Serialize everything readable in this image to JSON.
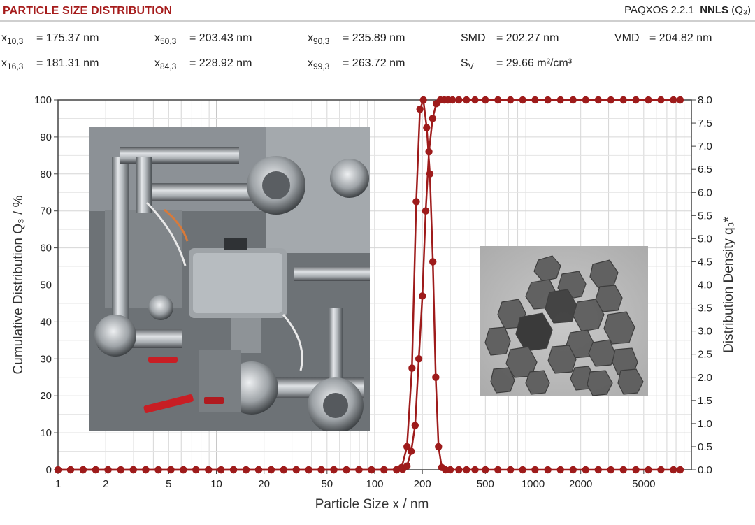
{
  "header": {
    "title": "PARTICLE SIZE DISTRIBUTION",
    "software": "PAQXOS 2.2.1",
    "method": "NNLS",
    "qtype": "(Q₃)"
  },
  "stats": [
    {
      "sym": "x",
      "sub": "10,3",
      "value": "= 175.37 nm"
    },
    {
      "sym": "x",
      "sub": "50,3",
      "value": "= 203.43 nm"
    },
    {
      "sym": "x",
      "sub": "90,3",
      "value": "= 235.89 nm"
    },
    {
      "sym": "SMD",
      "sub": "",
      "value": "= 202.27 nm"
    },
    {
      "sym": "VMD",
      "sub": "",
      "value": "= 204.82 nm"
    },
    {
      "sym": "x",
      "sub": "16,3",
      "value": "= 181.31 nm"
    },
    {
      "sym": "x",
      "sub": "84,3",
      "value": "= 228.92 nm"
    },
    {
      "sym": "x",
      "sub": "99,3",
      "value": "= 263.72 nm"
    },
    {
      "sym": "S",
      "sub": "V",
      "value": "= 29.66 m²/cm³"
    }
  ],
  "images": {
    "left_photo": "industrial-piping-apparatus-photo",
    "right_photo": "tem-nanoparticle-micrograph"
  },
  "chart_data": {
    "type": "line",
    "x_scale": "log",
    "xlabel": "Particle Size x / nm",
    "ylabel": "Cumulative Distribution Q₃ / %",
    "y2label": "Distribution Density q₃*",
    "xlim": [
      1,
      10000
    ],
    "ylim": [
      0,
      100
    ],
    "y2lim": [
      0,
      8.0
    ],
    "grid": true,
    "xticks": [
      {
        "v": 1,
        "label": "1"
      },
      {
        "v": 2,
        "label": "2"
      },
      {
        "v": 5,
        "label": "5"
      },
      {
        "v": 10,
        "label": "10"
      },
      {
        "v": 20,
        "label": "20"
      },
      {
        "v": 50,
        "label": "50"
      },
      {
        "v": 100,
        "label": "100"
      },
      {
        "v": 200,
        "label": "200"
      },
      {
        "v": 500,
        "label": "500"
      },
      {
        "v": 1000,
        "label": "1000"
      },
      {
        "v": 2000,
        "label": "2000"
      },
      {
        "v": 5000,
        "label": "5000"
      }
    ],
    "yticks": [
      "0",
      "10",
      "20",
      "30",
      "40",
      "50",
      "60",
      "70",
      "80",
      "90",
      "100"
    ],
    "y2ticks": [
      "0.0",
      "0.5",
      "1.0",
      "1.5",
      "2.0",
      "2.5",
      "3.0",
      "3.5",
      "4.0",
      "4.5",
      "5.0",
      "5.5",
      "6.0",
      "6.5",
      "7.0",
      "7.5",
      "8.0"
    ],
    "color": "#9e1b1b",
    "series": [
      {
        "role": "cumulative",
        "axis": "left",
        "x": [
          1,
          1.2,
          1.44,
          1.73,
          2.07,
          2.49,
          2.99,
          3.58,
          4.3,
          5.16,
          6.19,
          7.43,
          8.92,
          10.7,
          12.84,
          15.4,
          18.49,
          22.19,
          26.62,
          31.95,
          38.34,
          46.0,
          55.2,
          66.25,
          79.5,
          95.4,
          114.5,
          137.4,
          150,
          158,
          166,
          175,
          185,
          194,
          203,
          213,
          222,
          232,
          242,
          252,
          262,
          275,
          290,
          310,
          340,
          380,
          430,
          500,
          600,
          720,
          860,
          1030,
          1240,
          1490,
          1790,
          2150,
          2580,
          3100,
          3720,
          4460,
          5350,
          6420,
          7700,
          8500
        ],
        "values": [
          0,
          0,
          0,
          0,
          0,
          0,
          0,
          0,
          0,
          0,
          0,
          0,
          0,
          0,
          0,
          0,
          0,
          0,
          0,
          0,
          0,
          0,
          0,
          0,
          0,
          0,
          0,
          0,
          0.6,
          3,
          12,
          29,
          57,
          81,
          95,
          92,
          80,
          64,
          50,
          36,
          23,
          10,
          100,
          100,
          100,
          100,
          100,
          100,
          100,
          100,
          100,
          100,
          100,
          100,
          100,
          100,
          100,
          100,
          100,
          100,
          100,
          100,
          100,
          100
        ]
      }
    ],
    "cumulative_points": {
      "x": [
        1,
        1.2,
        1.44,
        1.73,
        2.07,
        2.49,
        2.99,
        3.58,
        4.3,
        5.16,
        6.19,
        7.43,
        8.92,
        10.7,
        12.84,
        15.4,
        18.49,
        22.19,
        26.62,
        31.95,
        38.34,
        46.0,
        55.2,
        66.25,
        79.5,
        95.4,
        114.5,
        137.4,
        150,
        160,
        170,
        180,
        190,
        200,
        210,
        220,
        232,
        245,
        260,
        275,
        290,
        310,
        340,
        380,
        430,
        500,
        600,
        720,
        860,
        1030,
        1240,
        1490,
        1790,
        2150,
        2580,
        3100,
        3720,
        4460,
        5350,
        6420,
        7700,
        8500
      ],
      "values": [
        0,
        0,
        0,
        0,
        0,
        0,
        0,
        0,
        0,
        0,
        0,
        0,
        0,
        0,
        0,
        0,
        0,
        0,
        0,
        0,
        0,
        0,
        0,
        0,
        0,
        0,
        0,
        0,
        0.1,
        1,
        5,
        12,
        30,
        47,
        70,
        86,
        95,
        99,
        100,
        100,
        100,
        100,
        100,
        100,
        100,
        100,
        100,
        100,
        100,
        100,
        100,
        100,
        100,
        100,
        100,
        100,
        100,
        100,
        100,
        100,
        100,
        100
      ]
    },
    "density_points": {
      "x": [
        1,
        1.2,
        1.44,
        1.73,
        2.07,
        2.49,
        2.99,
        3.58,
        4.3,
        5.16,
        6.19,
        7.43,
        8.92,
        10.7,
        12.84,
        15.4,
        18.49,
        22.19,
        26.62,
        31.95,
        38.34,
        46.0,
        55.2,
        66.25,
        79.5,
        95.4,
        114.5,
        137.4,
        148,
        160,
        172,
        183,
        193,
        203,
        213,
        223,
        233,
        243,
        253,
        265,
        280,
        300,
        340,
        380,
        430,
        500,
        600,
        720,
        860,
        1030,
        1240,
        1490,
        1790,
        2150,
        2580,
        3100,
        3720,
        4460,
        5350,
        6420,
        7700,
        8500
      ],
      "values": [
        0,
        0,
        0,
        0,
        0,
        0,
        0,
        0,
        0,
        0,
        0,
        0,
        0,
        0,
        0,
        0,
        0,
        0,
        0,
        0,
        0,
        0,
        0,
        0,
        0,
        0,
        0,
        0,
        0.05,
        0.5,
        2.2,
        5.8,
        7.8,
        8.0,
        7.4,
        6.4,
        4.5,
        2.0,
        0.5,
        0.05,
        0,
        0,
        0,
        0,
        0,
        0,
        0,
        0,
        0,
        0,
        0,
        0,
        0,
        0,
        0,
        0,
        0,
        0,
        0,
        0,
        0,
        0
      ]
    }
  }
}
